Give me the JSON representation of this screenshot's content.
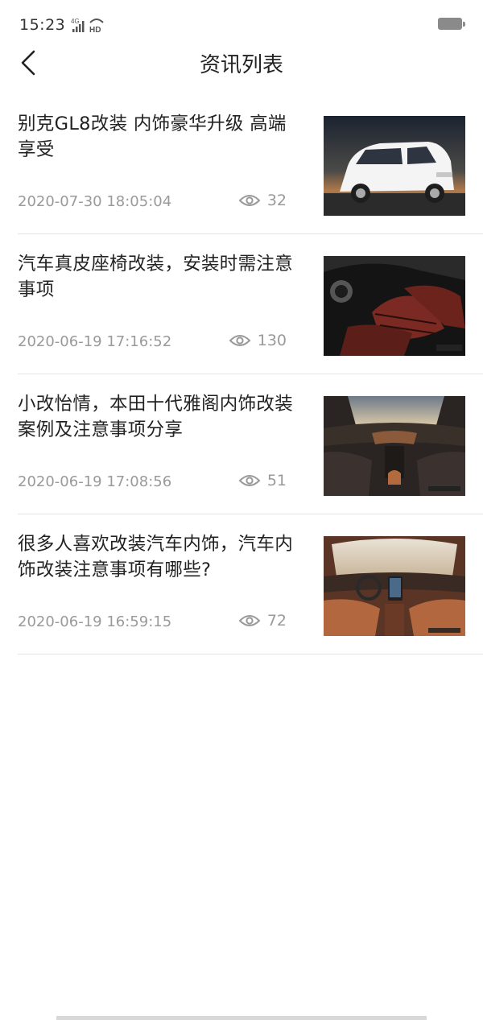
{
  "status_bar": {
    "time": "15:23",
    "network": "4G",
    "hd": "HD"
  },
  "nav": {
    "title": "资讯列表",
    "back_icon": "chevron-left-icon"
  },
  "news": [
    {
      "title": "别克GL8改装 内饰豪华升级 高端享受",
      "date": "2020-07-30 18:05:04",
      "views": "32",
      "image": "white-minivan-exterior"
    },
    {
      "title": "汽车真皮座椅改装，安装时需注意事项",
      "date": "2020-06-19 17:16:52",
      "views": "130",
      "image": "red-leather-car-seats"
    },
    {
      "title": "小改怡情，本田十代雅阁内饰改装案例及注意事项分享",
      "date": "2020-06-19 17:08:56",
      "views": "51",
      "image": "brown-car-interior"
    },
    {
      "title": "很多人喜欢改装汽车内饰，汽车内饰改装注意事项有哪些?",
      "date": "2020-06-19 16:59:15",
      "views": "72",
      "image": "orange-minivan-interior"
    }
  ]
}
